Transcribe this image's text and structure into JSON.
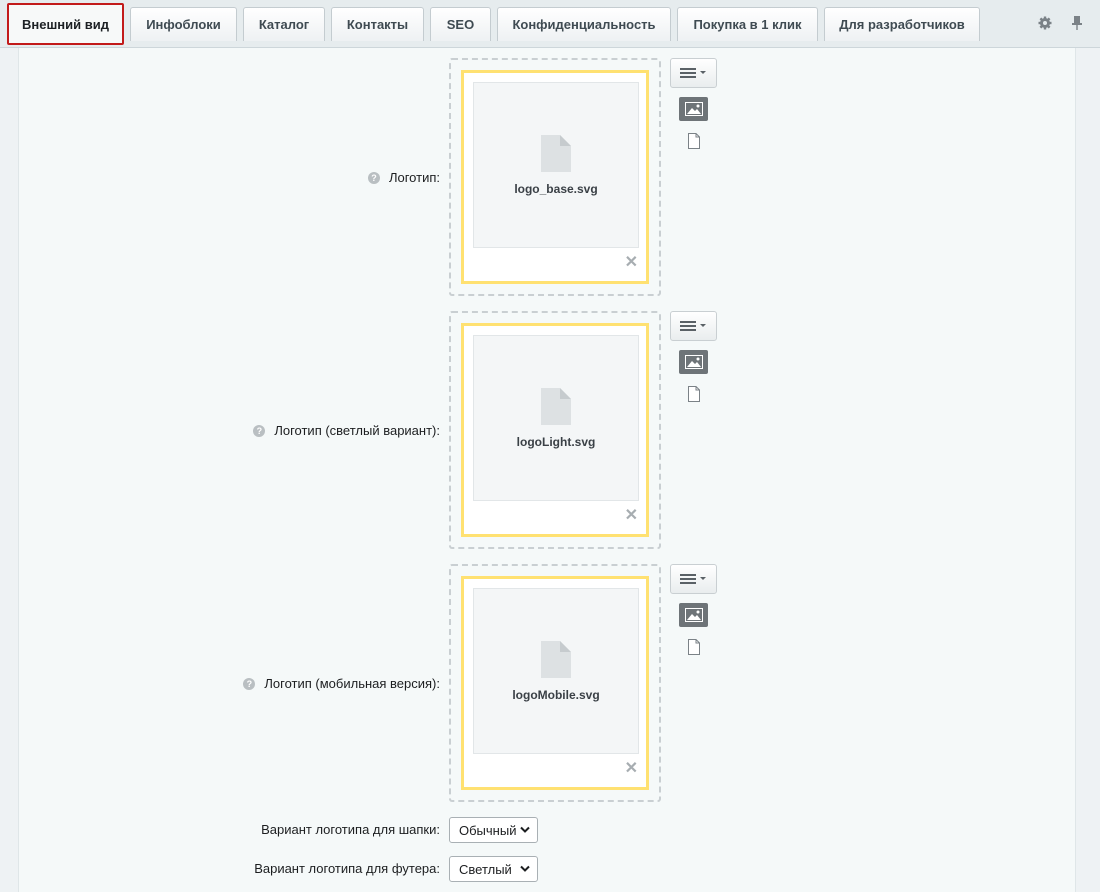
{
  "tabs": [
    {
      "label": "Внешний вид",
      "active": true
    },
    {
      "label": "Инфоблоки"
    },
    {
      "label": "Каталог"
    },
    {
      "label": "Контакты"
    },
    {
      "label": "SEO"
    },
    {
      "label": "Конфиденциальность"
    },
    {
      "label": "Покупка в 1 клик"
    },
    {
      "label": "Для разработчиков"
    }
  ],
  "tab_tools": {
    "settings_icon": "gear-icon",
    "pin_icon": "pin-icon"
  },
  "logo_fields": [
    {
      "label": "Логотип:",
      "file_name": "logo_base.svg"
    },
    {
      "label": "Логотип (светлый вариант):",
      "file_name": "logoLight.svg"
    },
    {
      "label": "Логотип (мобильная версия):",
      "file_name": "logoMobile.svg"
    }
  ],
  "help_icon": "?",
  "remove_icon": "✕",
  "select_fields": [
    {
      "label": "Вариант логотипа для шапки:",
      "value": "Обычный"
    },
    {
      "label": "Вариант логотипа для футера:",
      "value": "Светлый"
    }
  ],
  "colors": {
    "active_tab_border": "#c21a1a",
    "card_border": "#ffe171",
    "background": "#f5f9f9"
  }
}
